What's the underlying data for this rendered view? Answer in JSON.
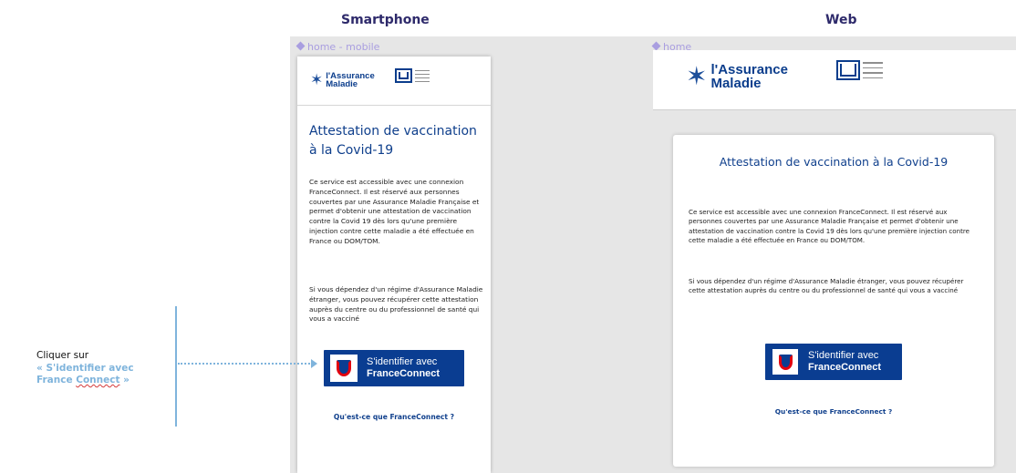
{
  "columns": {
    "smartphone": "Smartphone",
    "web": "Web"
  },
  "frames": {
    "mobile_label": "home - mobile",
    "web_label": "home"
  },
  "logo": {
    "brand_line1": "l'Assurance",
    "brand_line2": "Maladie"
  },
  "page": {
    "title_mobile": "Attestation de vaccination à la Covid-19",
    "title_web": "Attestation de vaccination à la Covid-19",
    "paragraph1": "Ce service est accessible avec une connexion FranceConnect. Il est réservé aux personnes couvertes par une Assurance Maladie Française et permet d'obtenir une attestation de vaccination contre la Covid 19 dès lors qu'une première injection contre cette maladie a été effectuée en France ou DOM/TOM.",
    "paragraph2": "Si vous dépendez d'un régime d'Assurance Maladie étranger, vous pouvez récupérer cette attestation auprès du centre ou du professionnel de santé qui vous a vacciné",
    "fc_button_line1": "S'identifier avec",
    "fc_button_line2": "FranceConnect",
    "fc_link": "Qu'est-ce que FranceConnect ?"
  },
  "annotation": {
    "line1": "Cliquer sur",
    "line2": "« S'identifier avec",
    "line3_prefix": "France ",
    "line3_word": "Connect",
    "line3_suffix": " »"
  },
  "colors": {
    "brand_blue": "#0f3f8c",
    "fc_button": "#0a3d91",
    "annotation": "#7fb4dc",
    "column_title": "#2e2a6b",
    "frame_label": "#a99ee0"
  }
}
